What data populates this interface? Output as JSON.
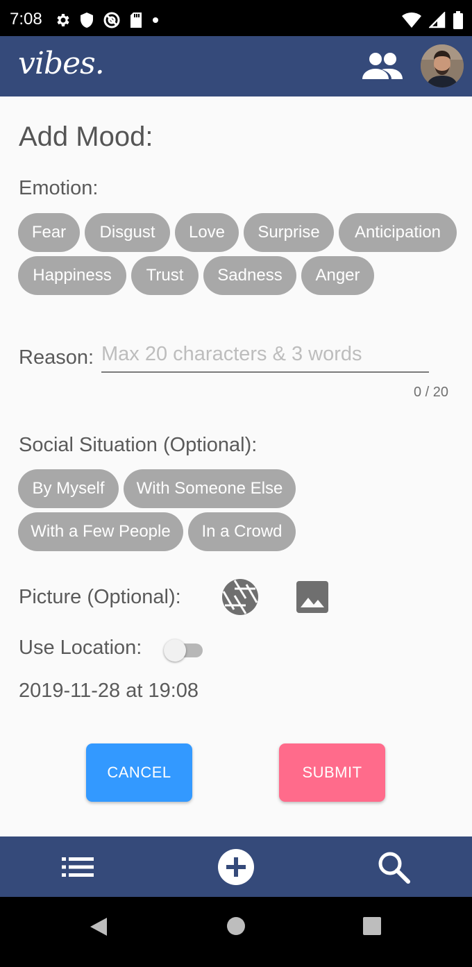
{
  "status_bar": {
    "time": "7:08",
    "left_icons": [
      "settings-icon",
      "shield-icon",
      "at-sign-icon",
      "sd-card-icon",
      "dot-icon"
    ],
    "right_icons": [
      "wifi-icon",
      "signal-icon",
      "battery-icon"
    ]
  },
  "app_bar": {
    "logo": "vibes.",
    "people_icon": "people-icon",
    "avatar": "user-avatar"
  },
  "form": {
    "title": "Add Mood:",
    "emotion_label": "Emotion:",
    "emotions": [
      "Fear",
      "Disgust",
      "Love",
      "Surprise",
      "Anticipation",
      "Happiness",
      "Trust",
      "Sadness",
      "Anger"
    ],
    "reason_label": "Reason:",
    "reason_value": "",
    "reason_placeholder": "Max 20 characters & 3 words",
    "reason_counter": "0 / 20",
    "social_label": "Social Situation (Optional):",
    "social_options": [
      "By Myself",
      "With Someone Else",
      "With a Few People",
      "In a Crowd"
    ],
    "picture_label": "Picture (Optional):",
    "location_label": "Use Location:",
    "location_enabled": false,
    "datetime": "2019-11-28 at 19:08",
    "cancel_label": "CANCEL",
    "submit_label": "SUBMIT"
  },
  "bottom_nav": {
    "items": [
      "list-icon",
      "add-circle-icon",
      "search-icon"
    ]
  },
  "system_nav": [
    "back-icon",
    "home-icon",
    "recents-icon"
  ],
  "colors": {
    "app_bar": "#354a7a",
    "chip": "#a8a8a8",
    "cancel": "#3399ff",
    "submit": "#ff6b8b"
  }
}
